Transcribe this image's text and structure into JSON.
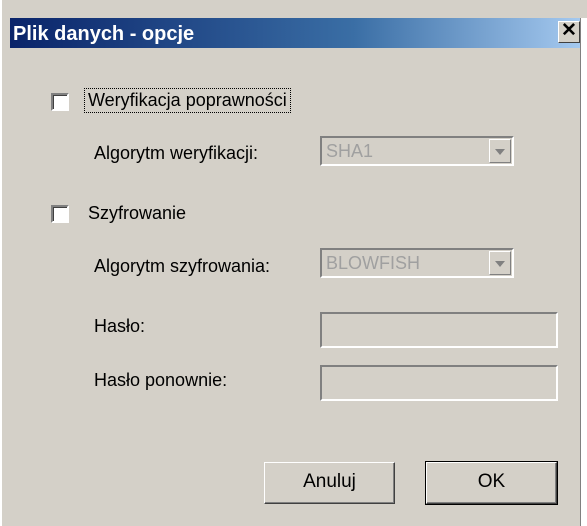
{
  "window": {
    "title": "Plik danych - opcje",
    "close_glyph": "✕"
  },
  "verification": {
    "checkbox_label": "Weryfikacja poprawności",
    "checked": false,
    "algorithm_label": "Algorytm weryfikacji:",
    "algorithm_value": "SHA1"
  },
  "encryption": {
    "checkbox_label": "Szyfrowanie",
    "checked": false,
    "algorithm_label": "Algorytm szyfrowania:",
    "algorithm_value": "BLOWFISH",
    "password_label": "Hasło:",
    "password_value": "",
    "password_repeat_label": "Hasło ponownie:",
    "password_repeat_value": ""
  },
  "buttons": {
    "cancel_label": "Anuluj",
    "ok_label": "OK"
  },
  "colors": {
    "titlebar_start": "#0a246a",
    "titlebar_end": "#a6caf0",
    "face": "#d4d0c8",
    "disabled_text": "#a0a0a0"
  }
}
